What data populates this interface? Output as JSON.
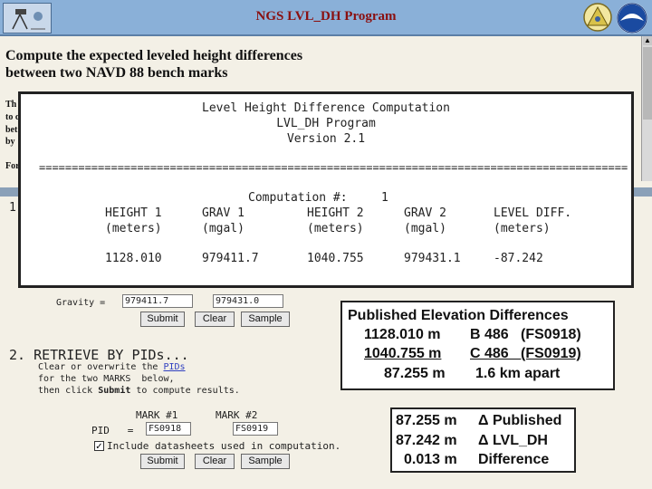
{
  "header": {
    "title": "NGS LVL_DH Program",
    "left_logo_icon": "survey-instrument-icon",
    "right_icons": [
      "survey-seal-icon",
      "noaa-logo-icon"
    ]
  },
  "intro": {
    "heading_line1": "Compute the expected leveled height differences",
    "heading_line2": "between two NAVD 88 bench marks",
    "frag1": "Th",
    "frag2": "to c",
    "frag3": "bet",
    "frag4": "by",
    "frag5": "For",
    "frag6": "1"
  },
  "output": {
    "line1": "Level Height Difference Computation",
    "line2": "LVL_DH Program",
    "line3": "Version 2.1",
    "separator": "================================================================================================",
    "comp_label": "Computation #:",
    "comp_number": "1",
    "columns": [
      {
        "header": "HEIGHT 1",
        "unit": "(meters)",
        "value": "1128.010"
      },
      {
        "header": "GRAV 1",
        "unit": "(mgal)",
        "value": "979411.7"
      },
      {
        "header": "HEIGHT 2",
        "unit": "(meters)",
        "value": "1040.755"
      },
      {
        "header": "GRAV 2",
        "unit": "(mgal)",
        "value": "979431.1"
      },
      {
        "header": "LEVEL DIFF.",
        "unit": "(meters)",
        "value": "-87.242"
      }
    ]
  },
  "form1": {
    "gravity_label": "Gravity =",
    "gravity1": "979411.7",
    "gravity2": "979431.0",
    "submit": "Submit",
    "clear": "Clear",
    "sample": "Sample"
  },
  "form2": {
    "title": "2. RETRIEVE BY PIDs...",
    "instr_a": "Clear or overwrite the",
    "instr_link": "PIDs",
    "instr_b": "for the two MARKS  below,",
    "instr_c1": "then click ",
    "instr_c_bold": "Submit",
    "instr_c2": " to compute results.",
    "mark1_label": "MARK #1",
    "mark2_label": "MARK #2",
    "pid_label": "PID   =",
    "pid1": "FS0918",
    "pid2": "FS0919",
    "checkbox_label": "Include datasheets used in computation.",
    "checkbox_checked": true,
    "submit": "Submit",
    "clear": "Clear",
    "sample": "Sample"
  },
  "published": {
    "title": "Published Elevation Differences",
    "row1_val": "1128.010 m",
    "row1_mark": "B 486   (FS0918)",
    "row2_val": "1040.755 m",
    "row2_mark": "C 486   (FS0919)",
    "row3_val": "87.255 m",
    "row3_mark": "1.6 km apart"
  },
  "comparison": {
    "r1_val": "87.255 m",
    "r1_label": "Δ Published",
    "r2_val": "87.242 m",
    "r2_label": "Δ LVL_DH",
    "r3_val": "0.013 m",
    "r3_label": "Difference"
  }
}
